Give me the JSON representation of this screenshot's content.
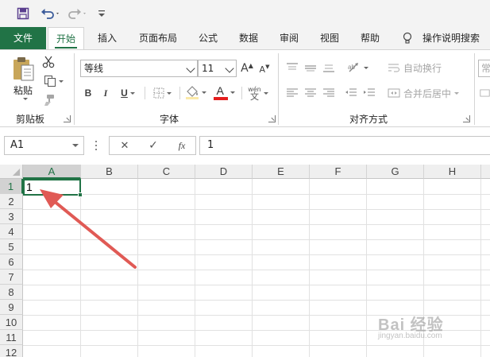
{
  "tabs": [
    {
      "label": "文件"
    },
    {
      "label": "开始"
    },
    {
      "label": "插入"
    },
    {
      "label": "页面布局"
    },
    {
      "label": "公式"
    },
    {
      "label": "数据"
    },
    {
      "label": "审阅"
    },
    {
      "label": "视图"
    },
    {
      "label": "帮助"
    }
  ],
  "tell_me": "操作说明搜索",
  "clipboard": {
    "paste_label": "粘贴",
    "group_label": "剪贴板"
  },
  "font": {
    "font_name": "等线",
    "font_size": "11",
    "bold": "B",
    "italic": "I",
    "underline": "U",
    "grow": "A",
    "shrink": "A",
    "font_color_glyph": "A",
    "phonetic_top": "wén",
    "phonetic_bottom": "文",
    "group_label": "字体"
  },
  "alignment": {
    "wrap_text": "自动换行",
    "merge_center": "合并后居中",
    "group_label": "对齐方式"
  },
  "number": {
    "format_partial": "常"
  },
  "formula_bar": {
    "name_box": "A1",
    "cancel_glyph": "✕",
    "enter_glyph": "✓",
    "fx_glyph": "fx",
    "value": "1"
  },
  "sheet": {
    "columns": [
      "A",
      "B",
      "C",
      "D",
      "E",
      "F",
      "G",
      "H"
    ],
    "rows": [
      "1",
      "2",
      "3",
      "4",
      "5",
      "6",
      "7",
      "8",
      "9",
      "10",
      "11",
      "12"
    ],
    "active_cell_value": "1"
  },
  "watermark": {
    "text": "Bai 经验",
    "url": "jingyan.baidu.com"
  },
  "colors": {
    "accent": "#217346",
    "arrow": "#e05a55"
  }
}
